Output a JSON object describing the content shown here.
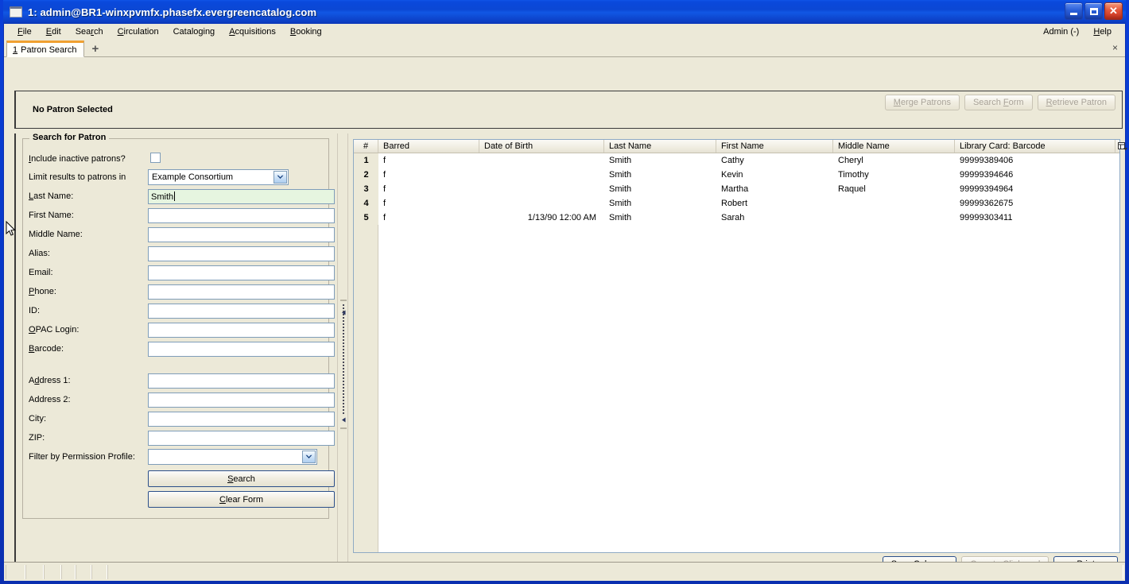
{
  "window": {
    "title": "1: admin@BR1-winxpvmfx.phasefx.evergreencatalog.com",
    "icon": "window-icon",
    "minimize_label": "",
    "maximize_label": "",
    "close_label": "✕"
  },
  "menubar": {
    "items": [
      {
        "label": "File",
        "accel": "F"
      },
      {
        "label": "Edit",
        "accel": "E"
      },
      {
        "label": "Search",
        "accel": "r"
      },
      {
        "label": "Circulation",
        "accel": "C"
      },
      {
        "label": "Cataloging",
        "accel": "g"
      },
      {
        "label": "Acquisitions",
        "accel": "A"
      },
      {
        "label": "Booking",
        "accel": "B"
      }
    ],
    "right_items": [
      {
        "label": "Admin (-)"
      },
      {
        "label": "Help"
      }
    ]
  },
  "tabs": {
    "active": {
      "number": "1",
      "label": "Patron Search"
    },
    "add_label": "+",
    "close_label": "×"
  },
  "patron_header": {
    "title": "No Patron Selected",
    "buttons": [
      {
        "label": "Merge Patrons",
        "enabled": false
      },
      {
        "label": "Search Form",
        "enabled": false
      },
      {
        "label": "Retrieve Patron",
        "enabled": false
      }
    ]
  },
  "search_form": {
    "group_title": "Search for Patron",
    "fields": [
      {
        "label": "Include inactive patrons?",
        "type": "checkbox",
        "value": "",
        "checked": false
      },
      {
        "label": "Limit results to patrons in",
        "type": "combo",
        "value": "Example Consortium"
      },
      {
        "label": "Last Name:",
        "type": "text",
        "value": "Smith",
        "focused": true
      },
      {
        "label": "First Name:",
        "type": "text",
        "value": ""
      },
      {
        "label": "Middle Name:",
        "type": "text",
        "value": ""
      },
      {
        "label": "Alias:",
        "type": "text",
        "value": ""
      },
      {
        "label": "Email:",
        "type": "text",
        "value": ""
      },
      {
        "label": "Phone:",
        "type": "text",
        "value": ""
      },
      {
        "label": "ID:",
        "type": "text",
        "value": ""
      },
      {
        "label": "OPAC Login:",
        "type": "text",
        "value": ""
      },
      {
        "label": "Barcode:",
        "type": "text",
        "value": ""
      },
      {
        "label": "Address 1:",
        "type": "text",
        "value": ""
      },
      {
        "label": "Address 2:",
        "type": "text",
        "value": ""
      },
      {
        "label": "City:",
        "type": "text",
        "value": ""
      },
      {
        "label": "ZIP:",
        "type": "text",
        "value": ""
      },
      {
        "label": "Filter by Permission Profile:",
        "type": "combo",
        "value": ""
      }
    ],
    "search_button": "Search",
    "clear_button": "Clear Form"
  },
  "results": {
    "columns": [
      {
        "key": "num",
        "label": "#"
      },
      {
        "key": "barred",
        "label": "Barred"
      },
      {
        "key": "dob",
        "label": "Date of Birth"
      },
      {
        "key": "last",
        "label": "Last Name"
      },
      {
        "key": "first",
        "label": "First Name"
      },
      {
        "key": "middle",
        "label": "Middle Name"
      },
      {
        "key": "barcode",
        "label": "Library Card: Barcode"
      }
    ],
    "column_picker_icon": "column-picker-icon",
    "rows": [
      {
        "num": "1",
        "barred": "f",
        "dob": "",
        "last": "Smith",
        "first": "Cathy",
        "middle": "Cheryl",
        "barcode": "99999389406"
      },
      {
        "num": "2",
        "barred": "f",
        "dob": "",
        "last": "Smith",
        "first": "Kevin",
        "middle": "Timothy",
        "barcode": "99999394646"
      },
      {
        "num": "3",
        "barred": "f",
        "dob": "",
        "last": "Smith",
        "first": "Martha",
        "middle": "Raquel",
        "barcode": "99999394964"
      },
      {
        "num": "4",
        "barred": "f",
        "dob": "",
        "last": "Smith",
        "first": "Robert",
        "middle": "",
        "barcode": "99999362675"
      },
      {
        "num": "5",
        "barred": "f",
        "dob": "1/13/90 12:00 AM",
        "last": "Smith",
        "first": "Sarah",
        "middle": "",
        "barcode": "99999303411"
      }
    ],
    "buttons": [
      {
        "label": "Save Columns",
        "enabled": true,
        "default": true
      },
      {
        "label": "Copy to Clipboard",
        "enabled": false,
        "default": false
      },
      {
        "label": "Print",
        "enabled": true,
        "default": true
      }
    ]
  },
  "statusbar": {
    "cells": [
      "",
      "",
      "",
      "",
      "",
      "",
      ""
    ]
  },
  "colors": {
    "titlebar_blue": "#0b47d4",
    "window_face": "#ece9d8",
    "tab_accent": "#f0a030",
    "field_focus": "#e6f5e0",
    "field_border": "#7f9db9"
  }
}
